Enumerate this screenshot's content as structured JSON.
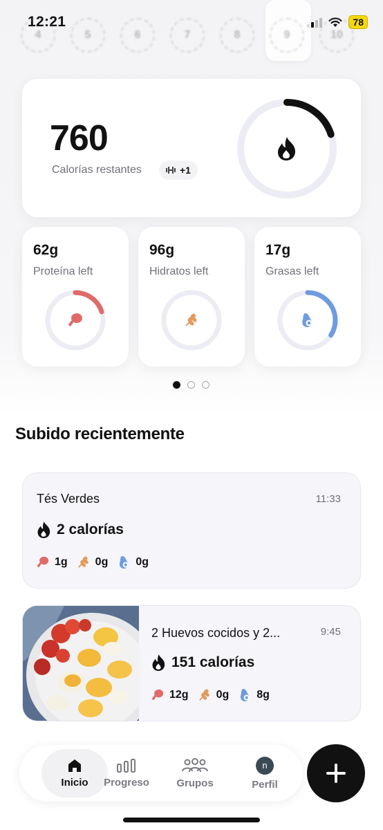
{
  "status": {
    "time": "12:21",
    "battery": "78"
  },
  "days": [
    "4",
    "5",
    "6",
    "7",
    "8",
    "9",
    "10"
  ],
  "calories": {
    "value": "760",
    "label": "Calorías restantes",
    "badge": "+1",
    "progress": 0.2
  },
  "macros": [
    {
      "value": "62g",
      "label": "Proteína left",
      "color": "#e06a6a",
      "icon": "drumstick-icon",
      "progress": 0.2
    },
    {
      "value": "96g",
      "label": "Hidratos left",
      "color": "#e29a5c",
      "icon": "wheat-icon",
      "progress": 0.0
    },
    {
      "value": "17g",
      "label": "Grasas left",
      "color": "#6f9be0",
      "icon": "avocado-icon",
      "progress": 0.34
    }
  ],
  "section_title": "Subido recientemente",
  "recent": [
    {
      "name": "Tés Verdes",
      "time": "11:33",
      "calories": "2 calorías",
      "protein": "1g",
      "carbs": "0g",
      "fat": "0g",
      "has_photo": false
    },
    {
      "name": "2 Huevos cocidos y 2...",
      "time": "9:45",
      "calories": "151 calorías",
      "protein": "12g",
      "carbs": "0g",
      "fat": "8g",
      "has_photo": true
    }
  ],
  "nav": {
    "items": [
      {
        "label": "Inicio",
        "icon": "home-icon"
      },
      {
        "label": "Progreso",
        "icon": "bar-chart-icon"
      },
      {
        "label": "Grupos",
        "icon": "group-icon"
      },
      {
        "label": "Perfil",
        "icon": "avatar-icon",
        "avatar_letter": "n"
      }
    ],
    "fab_icon": "plus-icon"
  },
  "colors": {
    "protein": "#e06a6a",
    "carbs": "#e29a5c",
    "fat": "#6f9be0",
    "ring_track": "#ececf4"
  }
}
